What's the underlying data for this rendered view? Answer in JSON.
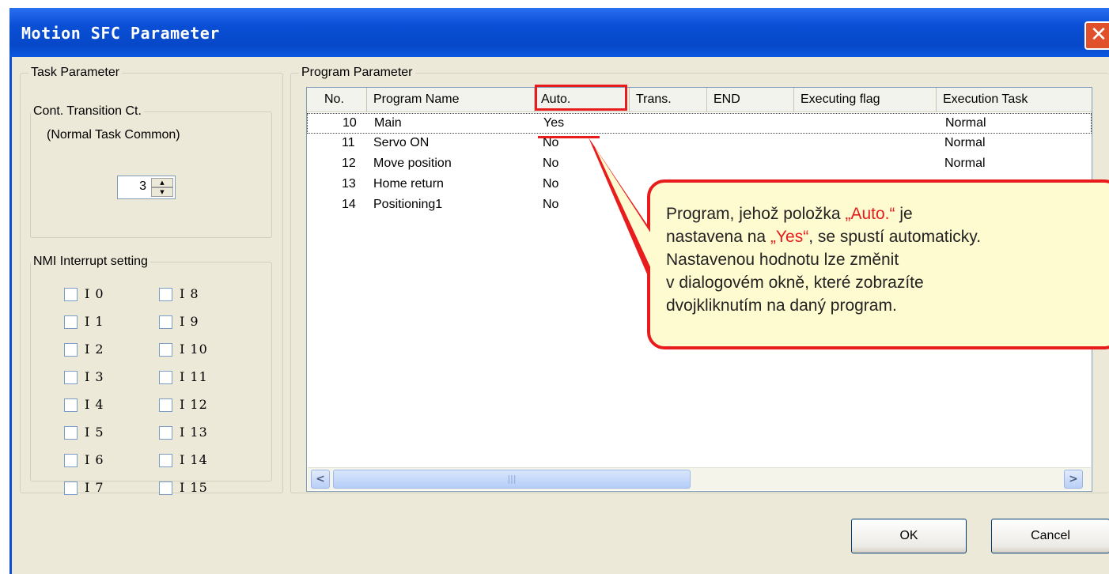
{
  "window": {
    "title": "Motion SFC Parameter",
    "close_symbol": "✕"
  },
  "task_parameter": {
    "label": "Task Parameter",
    "cont_transition": {
      "label": "Cont. Transition Ct.",
      "sublabel": "(Normal Task Common)",
      "value": "3",
      "up_symbol": "▲",
      "down_symbol": "▼"
    },
    "nmi": {
      "label": "NMI Interrupt setting",
      "left": [
        "I 0",
        "I 1",
        "I 2",
        "I 3",
        "I 4",
        "I 5",
        "I 6",
        "I 7"
      ],
      "right": [
        "I 8",
        "I 9",
        "I 10",
        "I 11",
        "I 12",
        "I 13",
        "I 14",
        "I 15"
      ]
    }
  },
  "program_parameter": {
    "label": "Program Parameter",
    "columns": [
      "No.",
      "Program Name",
      "Auto.",
      "Trans.",
      "END",
      "Executing flag",
      "Execution Task"
    ],
    "rows": [
      {
        "no": "10",
        "name": "Main",
        "auto": "Yes",
        "task": "Normal"
      },
      {
        "no": "11",
        "name": "Servo ON",
        "auto": "No",
        "task": "Normal"
      },
      {
        "no": "12",
        "name": "Move position",
        "auto": "No",
        "task": "Normal"
      },
      {
        "no": "13",
        "name": "Home return",
        "auto": "No",
        "task": ""
      },
      {
        "no": "14",
        "name": "Positioning1",
        "auto": "No",
        "task": ""
      }
    ],
    "scroll_left": "<",
    "scroll_right": ">",
    "scroll_grip": "|||"
  },
  "buttons": {
    "ok": "OK",
    "cancel": "Cancel"
  },
  "callout": {
    "l1a": "Program, jehož položka ",
    "l1b": "„Auto.“",
    "l1c": " je",
    "l2a": "nastavena na ",
    "l2b": "„Yes“",
    "l2c": ", se spustí automaticky.",
    "l3": "Nastavenou hodnotu lze změnit",
    "l4": "v dialogovém okně, které zobrazíte",
    "l5": "dvojkliknutím na daný program."
  },
  "colors": {
    "title_bar": "#0a4fd6",
    "dialog_bg": "#ece9d8",
    "highlight": "#e81c1c",
    "callout_bg": "#fffbd0"
  }
}
